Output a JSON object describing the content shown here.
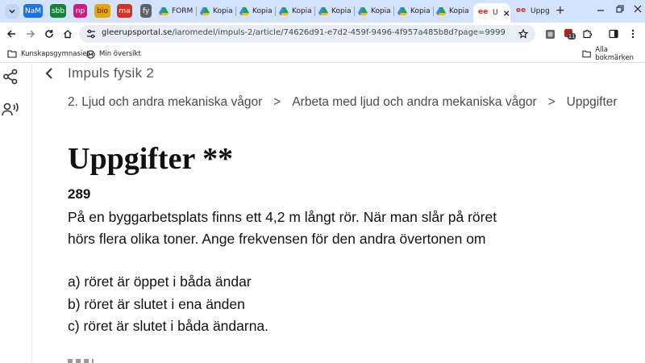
{
  "browser": {
    "tab_chips": [
      {
        "label": "NaM",
        "bg": "#1a73e8",
        "fg": "#ffffff"
      },
      {
        "label": "sbb",
        "bg": "#188038",
        "fg": "#ffffff"
      },
      {
        "label": "np",
        "bg": "#d01884",
        "fg": "#ffffff"
      },
      {
        "label": "bio",
        "bg": "#e8a400",
        "fg": "#1f1f1f"
      },
      {
        "label": "ma",
        "bg": "#d93025",
        "fg": "#ffffff"
      },
      {
        "label": "fy",
        "bg": "#5f6368",
        "fg": "#ffffff"
      }
    ],
    "tabs": [
      {
        "title": "FORM"
      },
      {
        "title": "Kopia"
      },
      {
        "title": "Kopia"
      },
      {
        "title": "Kopia"
      },
      {
        "title": "Kopia"
      },
      {
        "title": "Kopia"
      },
      {
        "title": "Kopia"
      },
      {
        "title": "Kopia"
      },
      {
        "title": "U"
      },
      {
        "title": "Uppg"
      }
    ],
    "new_tab_label": "+",
    "url_host": "gleerupsportal.se",
    "url_path": "/laromedel/impuls-2/article/74626d91-e7d2-459f-9496-4f957a485b8d?page=9999",
    "extension_badge": "11",
    "bookmarks": [
      {
        "label": "Kunskapsgymnasiet"
      },
      {
        "label": "Min översikt"
      }
    ],
    "all_bookmarks_label": "Alla bokmärken",
    "accent": "#d3e3fd"
  },
  "page": {
    "book_title": "Impuls fysik 2",
    "breadcrumbs": [
      "2. Ljud och andra mekaniska vågor",
      "Arbeta med ljud och andra mekaniska vågor",
      "Uppgifter"
    ],
    "breadcrumb_sep": ">",
    "heading": "Uppgifter **",
    "task_number": "289",
    "task_lines": [
      "På en byggarbetsplats finns ett 4,2 m långt rör. När man slår på röret",
      "hörs flera olika toner. Ange frekvensen för den andra övertonen om"
    ],
    "options": [
      "a) röret är öppet i båda ändar",
      "b) röret är slutet i ena änden",
      "c) röret är slutet i båda ändarna."
    ]
  }
}
